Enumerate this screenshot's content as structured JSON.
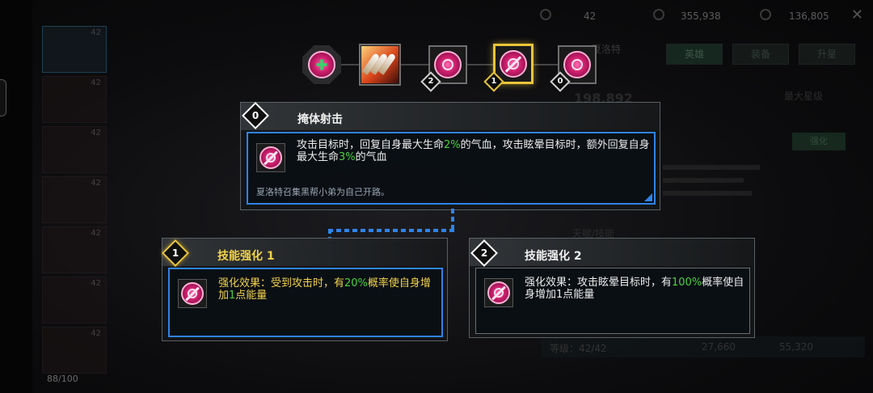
{
  "background": {
    "hero_list": [
      "42",
      "42",
      "42",
      "42",
      "42",
      "42",
      "42"
    ],
    "hero_count": "88/100",
    "resources": [
      "42",
      "355,938",
      "136,805"
    ],
    "tabs": [
      "英雄",
      "装备",
      "升星"
    ],
    "hero_name": "夏洛特",
    "power": "198,892",
    "label_right": "最大星级",
    "green_button": "强化",
    "skill_label": "天赋/技能",
    "level_text": "等级：42/42",
    "costs": [
      "27,660",
      "55,320"
    ]
  },
  "skill_tree": {
    "nodes": [
      {
        "name": "heal-skill",
        "badge": ""
      },
      {
        "name": "bullet-skill",
        "badge": ""
      },
      {
        "name": "grenade-skill",
        "badge": "2"
      },
      {
        "name": "cover-fire-skill",
        "badge": "1"
      },
      {
        "name": "gang-skill",
        "badge": "0"
      }
    ]
  },
  "main_card": {
    "level": "0",
    "title": "掩体射击",
    "desc_pre": "攻击目标时，回复自身最大生命",
    "desc_v1": "2%",
    "desc_mid": "的气血，攻击眩晕目标时，额外回复自身最大生命",
    "desc_v2": "3%",
    "desc_post": "的气血",
    "flavor": "夏洛特召集黑帮小弟为自己开路。"
  },
  "enhance_1": {
    "level": "1",
    "title": "技能强化 1",
    "desc_pre": "强化效果：受到攻击时，有",
    "desc_v1": "20%",
    "desc_mid": "概率使自身增加",
    "desc_v2": "1",
    "desc_post": "点能量"
  },
  "enhance_2": {
    "level": "2",
    "title": "技能强化 2",
    "desc_pre": "强化效果：攻击眩晕目标时，有",
    "desc_v1": "100%",
    "desc_post": "概率使自身增加1点能量"
  },
  "colors": {
    "accent_blue": "#2f83e8",
    "highlight_green": "#49d13d",
    "highlight_gold": "#e9c53a"
  }
}
